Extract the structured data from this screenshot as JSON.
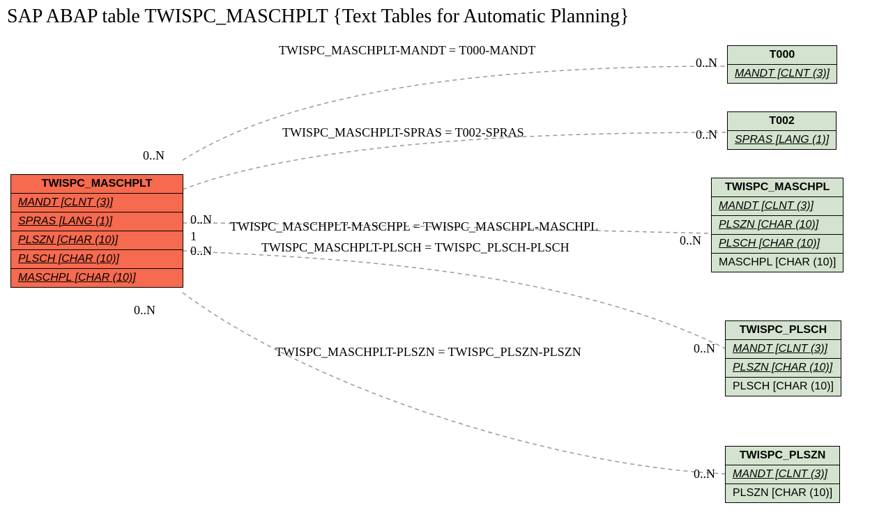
{
  "title": "SAP ABAP table TWISPC_MASCHPLT {Text Tables for Automatic Planning}",
  "main": {
    "name": "TWISPC_MASCHPLT",
    "rows": {
      "r0": "MANDT [CLNT (3)]",
      "r1": "SPRAS [LANG (1)]",
      "r2": "PLSZN [CHAR (10)]",
      "r3": "PLSCH [CHAR (10)]",
      "r4": "MASCHPL [CHAR (10)]"
    }
  },
  "t000": {
    "name": "T000",
    "rows": {
      "r0": "MANDT [CLNT (3)]"
    }
  },
  "t002": {
    "name": "T002",
    "rows": {
      "r0": "SPRAS [LANG (1)]"
    }
  },
  "maschpl": {
    "name": "TWISPC_MASCHPL",
    "rows": {
      "r0": "MANDT [CLNT (3)]",
      "r1": "PLSZN [CHAR (10)]",
      "r2": "PLSCH [CHAR (10)]",
      "r3": "MASCHPL [CHAR (10)]"
    }
  },
  "plsch": {
    "name": "TWISPC_PLSCH",
    "rows": {
      "r0": "MANDT [CLNT (3)]",
      "r1": "PLSZN [CHAR (10)]",
      "r2": "PLSCH [CHAR (10)]"
    }
  },
  "plszn": {
    "name": "TWISPC_PLSZN",
    "rows": {
      "r0": "MANDT [CLNT (3)]",
      "r1": "PLSZN [CHAR (10)]"
    }
  },
  "rel": {
    "r1": "TWISPC_MASCHPLT-MANDT = T000-MANDT",
    "r2": "TWISPC_MASCHPLT-SPRAS = T002-SPRAS",
    "r3": "TWISPC_MASCHPLT-MASCHPL = TWISPC_MASCHPL-MASCHPL",
    "r4": "TWISPC_MASCHPLT-PLSCH = TWISPC_PLSCH-PLSCH",
    "r5": "TWISPC_MASCHPLT-PLSZN = TWISPC_PLSZN-PLSZN"
  },
  "card": {
    "c0N": "0..N",
    "c1": "1"
  }
}
